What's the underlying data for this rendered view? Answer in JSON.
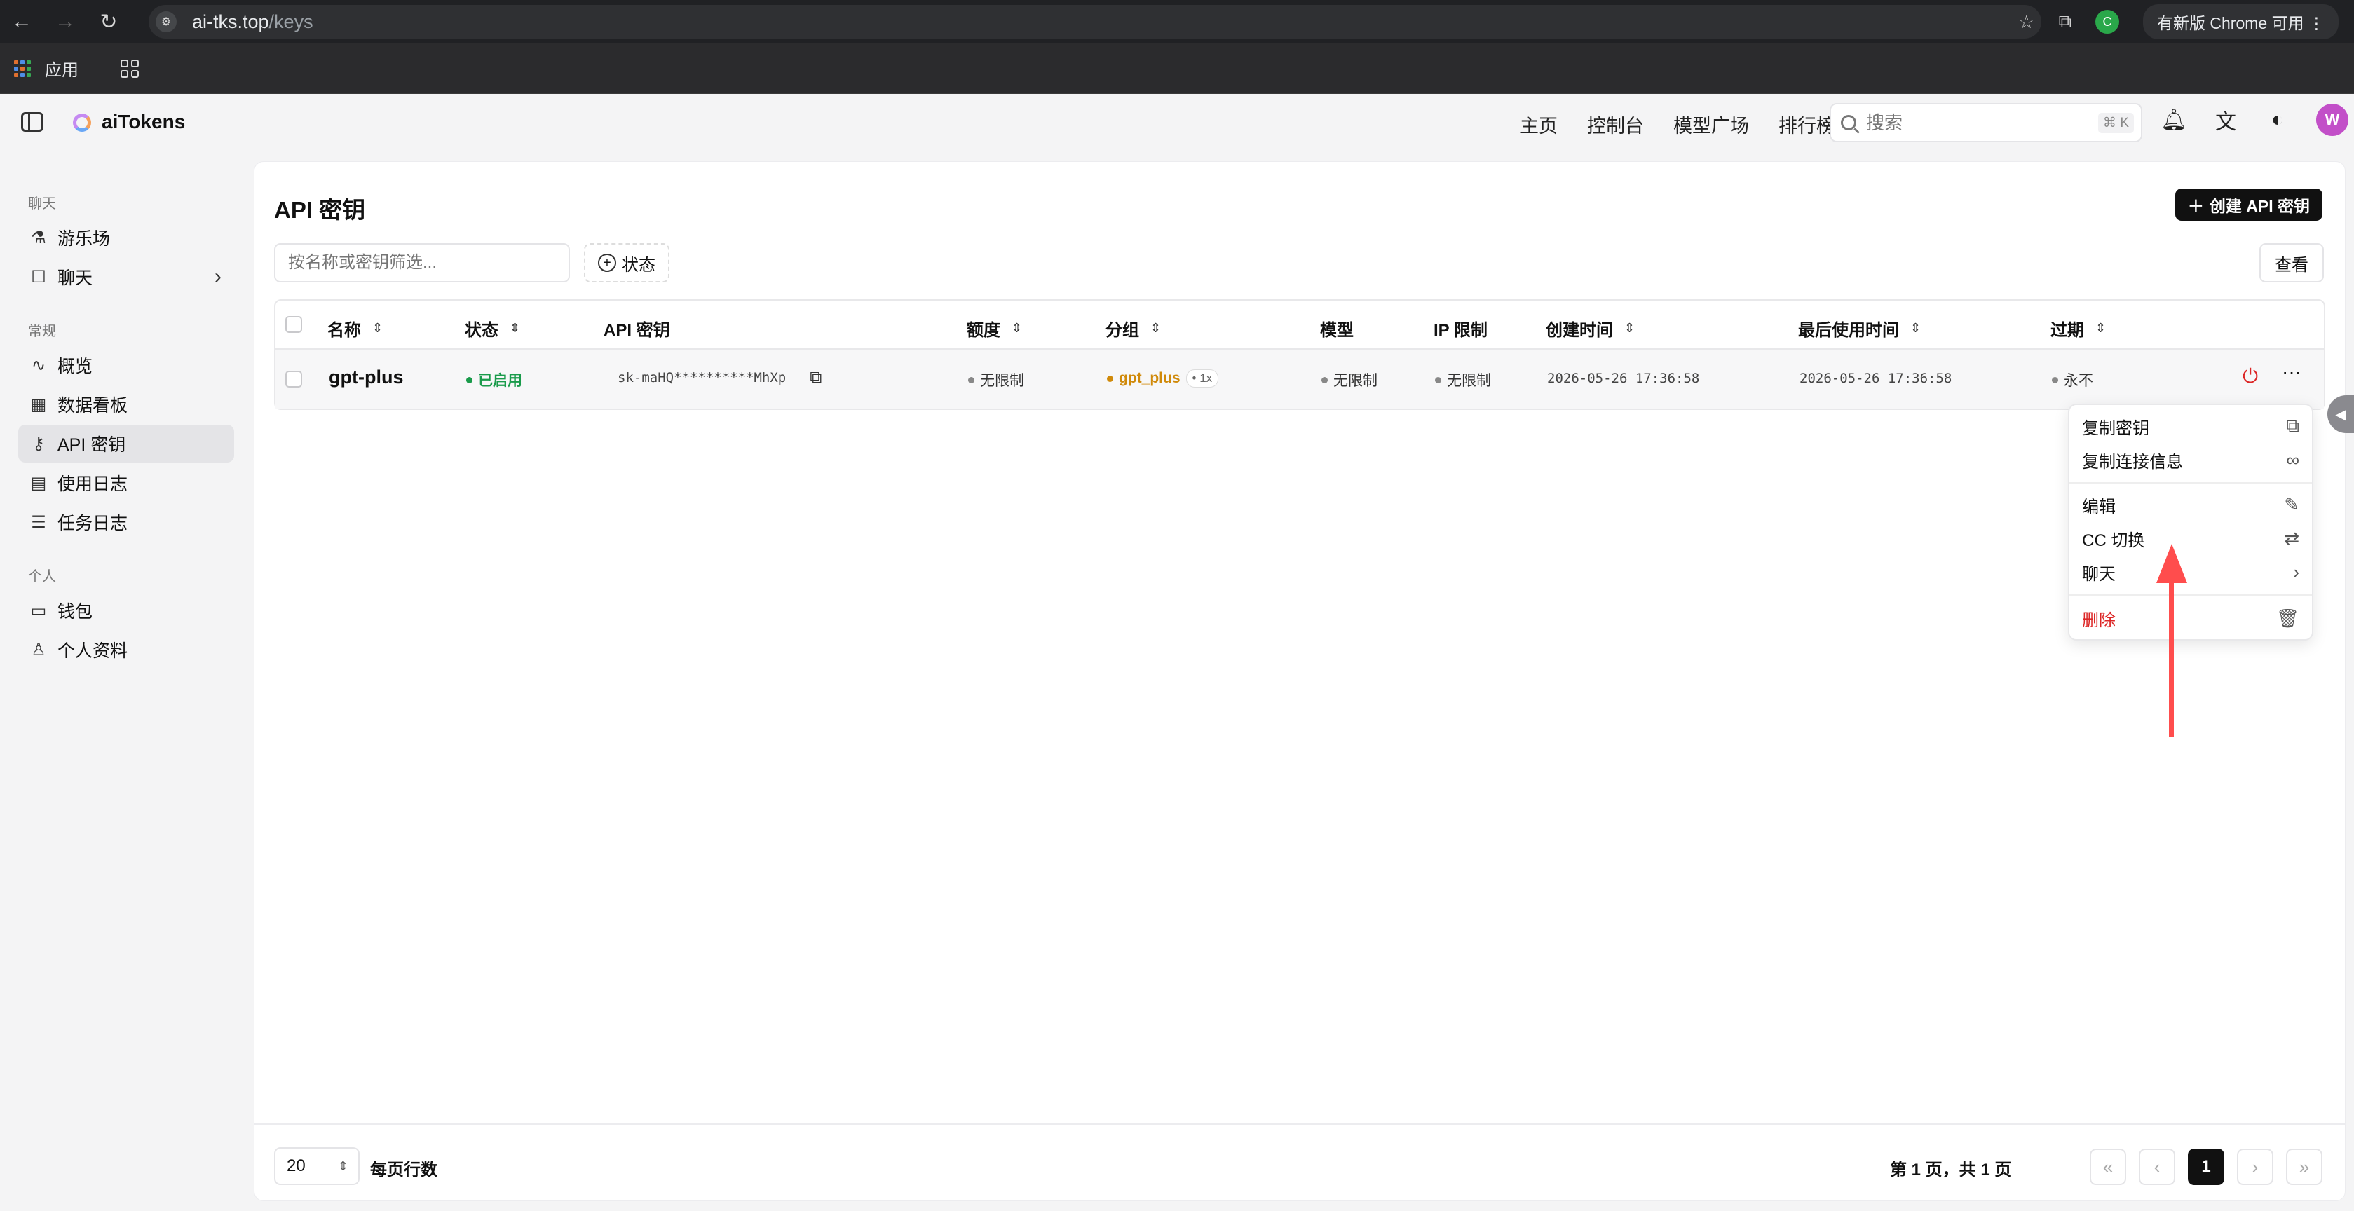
{
  "browser": {
    "url_host": "ai-tks.top",
    "url_path": "/keys",
    "update_label": "有新版 Chrome 可用",
    "profile_initial": "C",
    "bookmark_apps": "应用"
  },
  "header": {
    "brand": "aiTokens",
    "nav": [
      "主页",
      "控制台",
      "模型广场",
      "排行榜"
    ],
    "search_placeholder": "搜索",
    "search_shortcut": "⌘ K",
    "avatar_initial": "W"
  },
  "sidebar": {
    "sections": [
      {
        "title": "聊天",
        "items": [
          {
            "label": "游乐场",
            "icon": "flask-icon"
          },
          {
            "label": "聊天",
            "icon": "message-icon"
          }
        ]
      },
      {
        "title": "常规",
        "items": [
          {
            "label": "概览",
            "icon": "activity-icon"
          },
          {
            "label": "数据看板",
            "icon": "dashboard-icon"
          },
          {
            "label": "API 密钥",
            "icon": "key-icon"
          },
          {
            "label": "使用日志",
            "icon": "file-icon"
          },
          {
            "label": "任务日志",
            "icon": "list-checks-icon"
          }
        ]
      },
      {
        "title": "个人",
        "items": [
          {
            "label": "钱包",
            "icon": "wallet-icon"
          },
          {
            "label": "个人资料",
            "icon": "user-icon"
          }
        ]
      }
    ]
  },
  "page": {
    "title": "API 密钥",
    "create_label": "创建 API 密钥",
    "filter_placeholder": "按名称或密钥筛选...",
    "status_filter": "状态",
    "view_label": "查看"
  },
  "table": {
    "columns": [
      "名称",
      "状态",
      "API 密钥",
      "额度",
      "分组",
      "模型",
      "IP 限制",
      "创建时间",
      "最后使用时间",
      "过期"
    ],
    "rows": [
      {
        "name": "gpt-plus",
        "status": "已启用",
        "key": "sk-maHQ**********MhXp",
        "quota": "无限制",
        "group": "gpt_plus",
        "group_ratio": "1x",
        "model": "无限制",
        "ip": "无限制",
        "created": "2026-05-26 17:36:58",
        "last_used": "2026-05-26 17:36:58",
        "expires": "永不"
      }
    ]
  },
  "menu": {
    "copy_key": "复制密钥",
    "copy_conn": "复制连接信息",
    "edit": "编辑",
    "cc_switch": "CC 切换",
    "chat": "聊天",
    "delete": "删除"
  },
  "footer": {
    "rows_per_page_value": "20",
    "rows_per_page_label": "每页行数",
    "page_info": "第 1 页，共 1 页",
    "current_page": "1"
  },
  "colors": {
    "accent": "#111111",
    "enabled": "#1a9b4b",
    "group": "#d08a0a",
    "danger": "#dc2626",
    "annotation_arrow": "#ff4d4d"
  }
}
